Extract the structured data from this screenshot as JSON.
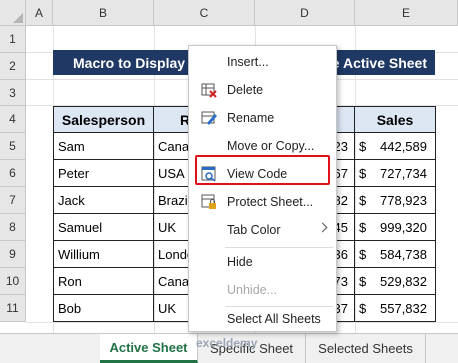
{
  "columns": [
    "A",
    "B",
    "C",
    "D",
    "E"
  ],
  "rows": [
    "1",
    "2",
    "3",
    "4",
    "5",
    "6",
    "7",
    "8",
    "9",
    "10",
    "11"
  ],
  "banner": {
    "left": "Macro to Display",
    "right": "e Active Sheet"
  },
  "table": {
    "headers": {
      "salesperson": "Salesperson",
      "region_partial": "R",
      "sales": "Sales"
    },
    "rows": [
      {
        "name": "Sam",
        "region": "Canad",
        "frag": "23",
        "currency": "$",
        "sales": "442,589"
      },
      {
        "name": "Peter",
        "region": "USA",
        "frag": "67",
        "currency": "$",
        "sales": "727,734"
      },
      {
        "name": "Jack",
        "region": "Brazil",
        "frag": "82",
        "currency": "$",
        "sales": "778,923"
      },
      {
        "name": "Samuel",
        "region": "UK",
        "frag": "45",
        "currency": "$",
        "sales": "999,320"
      },
      {
        "name": "Willium",
        "region": "Londo",
        "frag": "36",
        "currency": "$",
        "sales": "584,738"
      },
      {
        "name": "Ron",
        "region": "Canad",
        "frag": "73",
        "currency": "$",
        "sales": "529,832"
      },
      {
        "name": "Bob",
        "region": "UK",
        "frag": "37",
        "currency": "$",
        "sales": "557,832"
      }
    ]
  },
  "context_menu": {
    "insert": "Insert...",
    "delete": "Delete",
    "rename": "Rename",
    "move_copy": "Move or Copy...",
    "view_code": "View Code",
    "protect": "Protect Sheet...",
    "tab_color": "Tab Color",
    "hide": "Hide",
    "unhide": "Unhide...",
    "select_all": "Select All Sheets"
  },
  "tabs": {
    "active": "Active Sheet",
    "specific": "Specific Sheet",
    "selected": "Selected Sheets"
  },
  "watermark": "exceldemy",
  "colors": {
    "banner_bg": "#1f3864",
    "header_bg": "#dde7f4",
    "highlight": "#e0101a",
    "active_tab": "#217346"
  }
}
